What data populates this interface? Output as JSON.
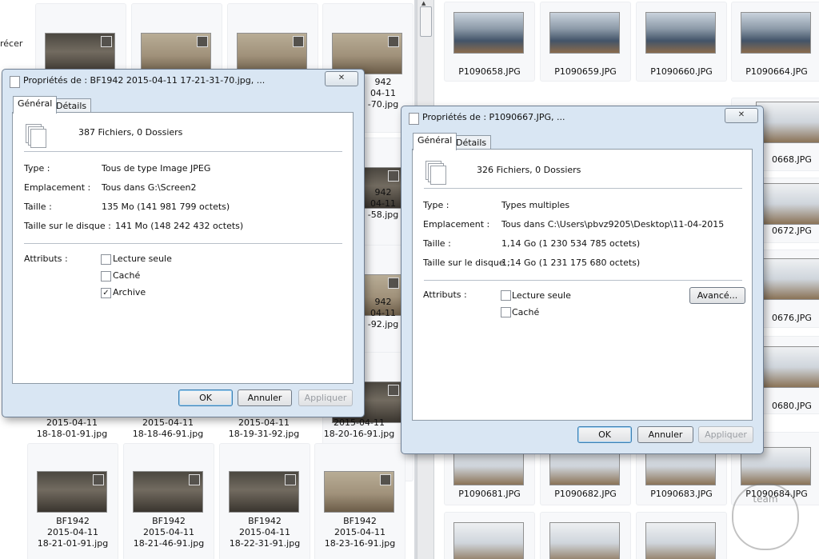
{
  "left_folder": {
    "truncated_text": "récer",
    "tiles_bottom": [
      {
        "line1": "2015-04-11",
        "line2": "18-18-01-91.jpg"
      },
      {
        "line1": "2015-04-11",
        "line2": "18-18-46-91.jpg"
      },
      {
        "line1": "2015-04-11",
        "line2": "18-19-31-92.jpg"
      },
      {
        "line1": "2015-04-11",
        "line2": "18-20-16-91.jpg"
      }
    ],
    "tiles_row2": [
      {
        "line0": "BF1942",
        "line1": "2015-04-11",
        "line2": "18-21-01-91.jpg"
      },
      {
        "line0": "BF1942",
        "line1": "2015-04-11",
        "line2": "18-21-46-91.jpg"
      },
      {
        "line0": "BF1942",
        "line1": "2015-04-11",
        "line2": "18-22-31-91.jpg"
      },
      {
        "line0": "BF1942",
        "line1": "2015-04-11",
        "line2": "18-23-16-91.jpg"
      }
    ],
    "peek_labels": [
      {
        "a": "942",
        "b": "04-11",
        "c": "-70.jpg"
      },
      {
        "a": "942",
        "b": "04-11",
        "c": "-58.jpg"
      },
      {
        "a": "942",
        "b": "04-11",
        "c": "-92.jpg"
      }
    ]
  },
  "right_folder": {
    "top_row": [
      "P1090658.JPG",
      "P1090659.JPG",
      "P1090660.JPG",
      "P1090664.JPG"
    ],
    "side_labels": [
      "0668.JPG",
      "0672.JPG",
      "0676.JPG",
      "0680.JPG"
    ],
    "bottom_row": [
      "P1090681.JPG",
      "P1090682.JPG",
      "P1090683.JPG",
      "P1090684.JPG"
    ]
  },
  "dialog1": {
    "title": "Propriétés de : BF1942 2015-04-11 17-21-31-70.jpg, ...",
    "close_glyph": "✕",
    "tabs": [
      "Général",
      "Détails"
    ],
    "summary": "387 Fichiers, 0 Dossiers",
    "fields": [
      {
        "label": "Type :",
        "value": "Tous de type Image JPEG"
      },
      {
        "label": "Emplacement :",
        "value": "Tous dans G:\\Screen2"
      },
      {
        "label": "Taille :",
        "value": "135 Mo (141 981 799 octets)"
      },
      {
        "label": "Taille sur le disque :",
        "value": "141 Mo (148 242 432 octets)"
      }
    ],
    "attributes_label": "Attributs :",
    "attributes": [
      {
        "label": "Lecture seule",
        "checked": false
      },
      {
        "label": "Caché",
        "checked": false
      },
      {
        "label": "Archive",
        "checked": true
      }
    ],
    "buttons": {
      "ok": "OK",
      "cancel": "Annuler",
      "apply": "Appliquer"
    }
  },
  "dialog2": {
    "title": "Propriétés de : P1090667.JPG, ...",
    "close_glyph": "✕",
    "tabs": [
      "Général",
      "Détails"
    ],
    "summary": "326 Fichiers, 0 Dossiers",
    "fields": [
      {
        "label": "Type :",
        "value": "Types multiples"
      },
      {
        "label": "Emplacement :",
        "value": "Tous dans C:\\Users\\pbvz9205\\Desktop\\11-04-2015"
      },
      {
        "label": "Taille :",
        "value": "1,14 Go (1 230 534 785 octets)"
      },
      {
        "label": "Taille sur le disque :",
        "value": "1,14 Go (1 231 175 680 octets)"
      }
    ],
    "attributes_label": "Attributs :",
    "attributes": [
      {
        "label": "Lecture seule",
        "checked": false
      },
      {
        "label": "Caché",
        "checked": false
      }
    ],
    "advanced_button": "Avancé...",
    "buttons": {
      "ok": "OK",
      "cancel": "Annuler",
      "apply": "Appliquer"
    }
  },
  "watermark": "team"
}
